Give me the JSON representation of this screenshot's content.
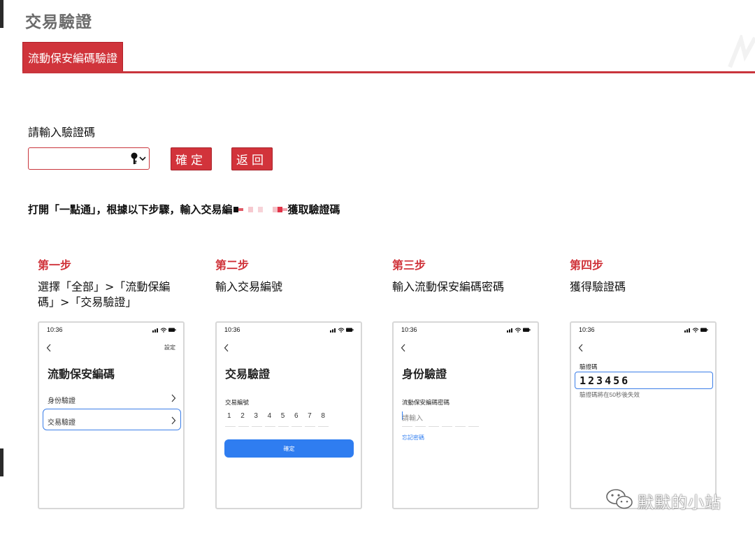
{
  "header": {
    "title": "交易驗證"
  },
  "tabs": [
    {
      "label": "流動保安編碼驗證",
      "active": true
    }
  ],
  "form": {
    "prompt": "請輸入驗證碼",
    "confirm_label": "確定",
    "back_label": "返回"
  },
  "instruction": {
    "before": "打開「一點通」，根據以下步驟，輸入交易編",
    "after": "獲取驗證碼"
  },
  "steps": [
    {
      "title": "第一步",
      "desc": "選擇「全部」>「流動保編碼」>「交易驗證」",
      "phone": {
        "time": "10:36",
        "right_link": "設定",
        "title": "流動保安編碼",
        "items": [
          "身份驗證",
          "交易驗證"
        ]
      }
    },
    {
      "title": "第二步",
      "desc": "輸入交易編號",
      "phone": {
        "time": "10:36",
        "title": "交易驗證",
        "field_label": "交易編號",
        "digits": [
          "1",
          "2",
          "3",
          "4",
          "5",
          "6",
          "7",
          "8"
        ],
        "button_label": "確定"
      }
    },
    {
      "title": "第三步",
      "desc": "輸入流動保安編碼密碼",
      "phone": {
        "time": "10:36",
        "title": "身份驗證",
        "field_label": "流動保安編碼密碼",
        "placeholder": "請輸入",
        "forgot_label": "忘記密碼"
      }
    },
    {
      "title": "第四步",
      "desc": "獲得驗證碼",
      "phone": {
        "time": "10:36",
        "field_label": "驗證碼",
        "code": "123456",
        "hint": "驗證碼將在50秒後失效"
      }
    }
  ],
  "watermark": {
    "text": "默默的小站"
  },
  "colors": {
    "accent": "#d0343b",
    "link_blue": "#2f7df0"
  },
  "icons": [
    "key-icon",
    "chevron-down-icon",
    "back-chevron-icon",
    "chevron-right-icon",
    "wechat-icon"
  ]
}
